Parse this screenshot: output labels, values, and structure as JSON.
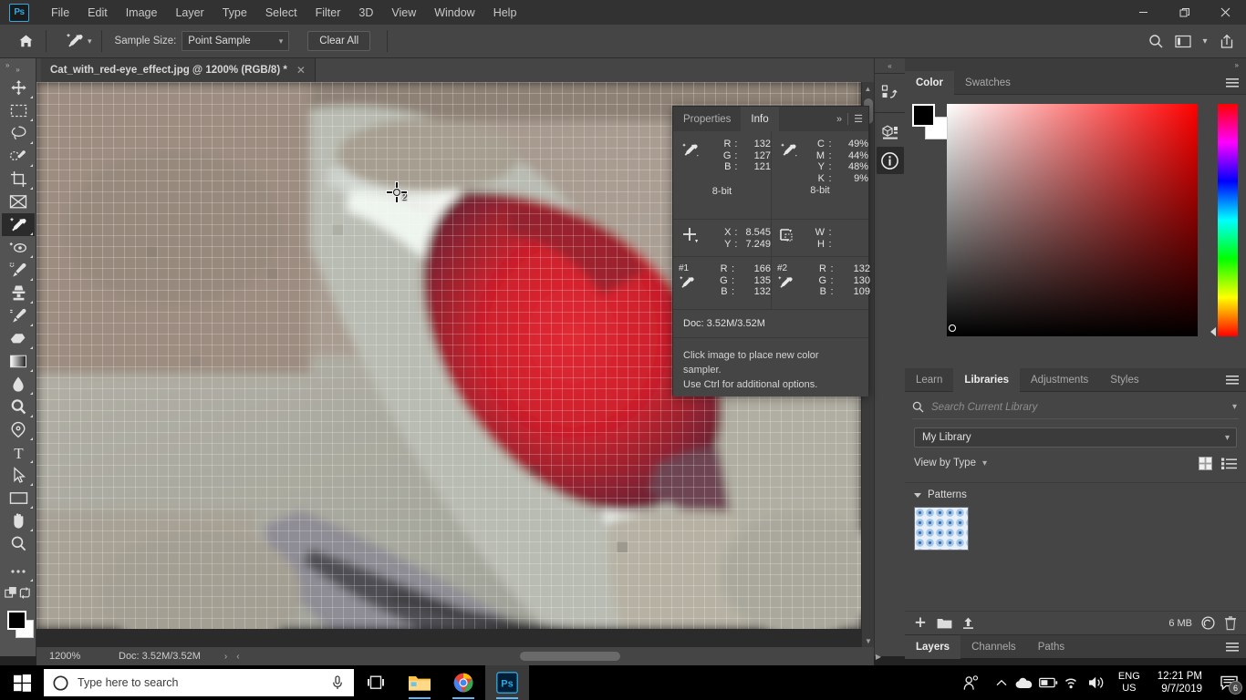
{
  "app": {
    "name": "Adobe Photoshop",
    "logo_text": "Ps"
  },
  "menubar": {
    "items": [
      "File",
      "Edit",
      "Image",
      "Layer",
      "Type",
      "Select",
      "Filter",
      "3D",
      "View",
      "Window",
      "Help"
    ]
  },
  "window_controls": {
    "minimize": "—",
    "maximize": "❐",
    "close": "✕"
  },
  "options_bar": {
    "home_icon": "home-icon",
    "tool_icon": "eyedropper-icon",
    "sample_size_label": "Sample Size:",
    "sample_size_value": "Point Sample",
    "clear_all_label": "Clear All",
    "right_icons": [
      "search-icon",
      "workspace-icon",
      "chevron-down-icon",
      "share-icon"
    ]
  },
  "toolbar": {
    "tools": [
      {
        "name": "move-tool",
        "glyph": "move"
      },
      {
        "name": "marquee-tool",
        "glyph": "marquee"
      },
      {
        "name": "lasso-tool",
        "glyph": "lasso"
      },
      {
        "name": "object-selection-tool",
        "glyph": "objsel"
      },
      {
        "name": "crop-tool",
        "glyph": "crop"
      },
      {
        "name": "frame-tool",
        "glyph": "frame"
      },
      {
        "name": "eyedropper-tool",
        "glyph": "eyedropper",
        "active": true
      },
      {
        "name": "spot-healing-tool",
        "glyph": "heal"
      },
      {
        "name": "brush-tool",
        "glyph": "brush"
      },
      {
        "name": "clone-stamp-tool",
        "glyph": "stamp"
      },
      {
        "name": "history-brush-tool",
        "glyph": "historybrush"
      },
      {
        "name": "eraser-tool",
        "glyph": "eraser"
      },
      {
        "name": "gradient-tool",
        "glyph": "gradient"
      },
      {
        "name": "blur-tool",
        "glyph": "blur"
      },
      {
        "name": "dodge-tool",
        "glyph": "dodge"
      },
      {
        "name": "pen-tool",
        "glyph": "pen"
      },
      {
        "name": "type-tool",
        "glyph": "type"
      },
      {
        "name": "path-selection-tool",
        "glyph": "pathsel"
      },
      {
        "name": "rectangle-tool",
        "glyph": "rect"
      },
      {
        "name": "hand-tool",
        "glyph": "hand"
      },
      {
        "name": "zoom-tool",
        "glyph": "zoom"
      },
      {
        "name": "edit-toolbar-button",
        "glyph": "dots"
      }
    ],
    "foreground_color": "#000000",
    "background_color": "#ffffff"
  },
  "document": {
    "tab_title": "Cat_with_red-eye_effect.jpg @ 1200% (RGB/8) *",
    "close_glyph": "✕"
  },
  "canvas": {
    "sampler_marker_label": "2"
  },
  "status_bar": {
    "zoom": "1200%",
    "doc": "Doc: 3.52M/3.52M",
    "next_arrow": "›",
    "prev_arrow": "‹"
  },
  "icon_dock": {
    "items": [
      "history-icon",
      "3d-icon",
      "info-icon"
    ]
  },
  "info_panel": {
    "tabs": [
      {
        "label": "Properties",
        "active": false
      },
      {
        "label": "Info",
        "active": true
      }
    ],
    "expand_glyph": "»",
    "menu_glyph": "☰",
    "rgb_readout": {
      "icon": "eyedropper-icon",
      "rows": [
        {
          "key": "R",
          "colon": ":",
          "value": "132"
        },
        {
          "key": "G",
          "colon": ":",
          "value": "127"
        },
        {
          "key": "B",
          "colon": ":",
          "value": "121"
        }
      ],
      "depth": "8-bit"
    },
    "cmyk_readout": {
      "icon": "eyedropper-icon",
      "rows": [
        {
          "key": "C",
          "colon": ":",
          "value": "49%"
        },
        {
          "key": "M",
          "colon": ":",
          "value": "44%"
        },
        {
          "key": "Y",
          "colon": ":",
          "value": "48%"
        },
        {
          "key": "K",
          "colon": ":",
          "value": "9%"
        }
      ],
      "depth": "8-bit"
    },
    "position_readout": {
      "icon": "crosshair-icon",
      "rows": [
        {
          "key": "X",
          "colon": ":",
          "value": "8.545"
        },
        {
          "key": "Y",
          "colon": ":",
          "value": "7.249"
        }
      ]
    },
    "size_readout": {
      "icon": "selection-size-icon",
      "rows": [
        {
          "key": "W",
          "colon": ":",
          "value": ""
        },
        {
          "key": "H",
          "colon": ":",
          "value": ""
        }
      ]
    },
    "sampler1": {
      "label": "#1",
      "icon": "eyedropper-icon",
      "rows": [
        {
          "key": "R",
          "colon": ":",
          "value": "166"
        },
        {
          "key": "G",
          "colon": ":",
          "value": "135"
        },
        {
          "key": "B",
          "colon": ":",
          "value": "132"
        }
      ]
    },
    "sampler2": {
      "label": "#2",
      "icon": "eyedropper-icon",
      "rows": [
        {
          "key": "R",
          "colon": ":",
          "value": "132"
        },
        {
          "key": "G",
          "colon": ":",
          "value": "130"
        },
        {
          "key": "B",
          "colon": ":",
          "value": "109"
        }
      ]
    },
    "doc_size": "Doc: 3.52M/3.52M",
    "hint_line1": "Click image to place new color sampler.",
    "hint_line2": "Use Ctrl for additional options."
  },
  "color_panel": {
    "tabs": [
      {
        "label": "Color",
        "active": true
      },
      {
        "label": "Swatches",
        "active": false
      }
    ],
    "menu_glyph": "☰",
    "foreground": "#000000",
    "background": "#ffffff",
    "ramp_start": "#ffffff",
    "ramp_end": "#ff0000"
  },
  "libraries_panel": {
    "tabs": [
      {
        "label": "Learn",
        "active": false
      },
      {
        "label": "Libraries",
        "active": true
      },
      {
        "label": "Adjustments",
        "active": false
      },
      {
        "label": "Styles",
        "active": false
      }
    ],
    "menu_glyph": "☰",
    "search_placeholder": "Search Current Library",
    "search_value": "",
    "library_select": "My Library",
    "view_by": "View by Type",
    "view_icons": [
      "grid-view-icon",
      "list-view-icon"
    ],
    "section_title": "Patterns",
    "items": [
      {
        "name": "pattern-thumbnail",
        "label": "blue dots pattern"
      }
    ],
    "footer": {
      "add_icon": "add-content-icon",
      "folder_icon": "new-library-icon",
      "upload_icon": "upload-icon",
      "size": "6 MB",
      "cloud_icon": "creative-cloud-icon",
      "delete_icon": "trash-icon"
    }
  },
  "layers_panel": {
    "tabs": [
      {
        "label": "Layers",
        "active": true
      },
      {
        "label": "Channels",
        "active": false
      },
      {
        "label": "Paths",
        "active": false
      }
    ],
    "menu_glyph": "☰"
  },
  "taskbar": {
    "start_icon": "windows-start-icon",
    "search_placeholder": "Type here to search",
    "search_icon": "cortana-icon",
    "mic_icon": "microphone-icon",
    "buttons": [
      {
        "name": "task-view-button",
        "icon": "task-view-icon"
      },
      {
        "name": "file-explorer-button",
        "icon": "file-explorer-icon"
      },
      {
        "name": "chrome-button",
        "icon": "chrome-icon"
      },
      {
        "name": "photoshop-button",
        "icon": "photoshop-icon"
      }
    ],
    "tray": {
      "people_icon": "people-icon",
      "chevron_icon": "show-hidden-icons-icon",
      "onedrive_icon": "onedrive-icon",
      "battery_icon": "battery-icon",
      "wifi_icon": "wifi-icon",
      "volume_icon": "volume-icon",
      "language_line1": "ENG",
      "language_line2": "US",
      "time": "12:21 PM",
      "date": "9/7/2019",
      "notification_icon": "action-center-icon",
      "notification_count": "6"
    }
  }
}
